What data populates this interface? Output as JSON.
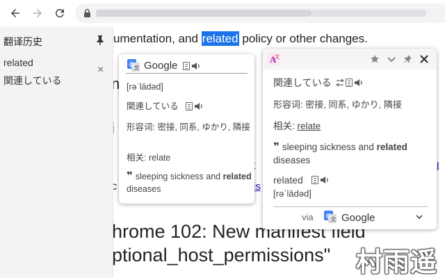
{
  "history": {
    "title": "翻译历史",
    "word": "related",
    "translation": "関連している",
    "close_glyph": "×"
  },
  "page": {
    "line1_before": "umentation, and ",
    "line1_highlight": "related",
    "line1_after": " policy or other changes.",
    "frag_n": "n",
    "frag_i": "i",
    "frag_t": "t",
    "frag_c": "c",
    "frag_link": "is",
    "right_link": "l",
    "heading1": "hrome 102: New manifest field",
    "heading2": "ptional_host_permissions\"",
    "watermark": "村雨遥"
  },
  "google_popup": {
    "provider": "Google",
    "phonetic": "[rəˈlādəd]",
    "translation": "関連している",
    "adjective": "形容词: 密接, 同系, ゆかり, 隣接",
    "related": "相关: relate",
    "example_before": "sleeping sickness and ",
    "example_bold": "related",
    "example_after": " diseases"
  },
  "right_popup": {
    "translation": "関連している",
    "adjective": "形容词: 密接, 同系, ゆかり, 隣接",
    "related_label": "相关: ",
    "related_link": "relate",
    "example_before": "sleeping sickness and ",
    "example_bold": "related",
    "example_after": " diseases",
    "word": "related",
    "phonetic": "[rəˈlādəd]",
    "via": "via",
    "provider": "Google"
  },
  "colors": {
    "highlight": "#1a73e8",
    "google_blue": "#4285f4",
    "link": "#1a0dab"
  }
}
